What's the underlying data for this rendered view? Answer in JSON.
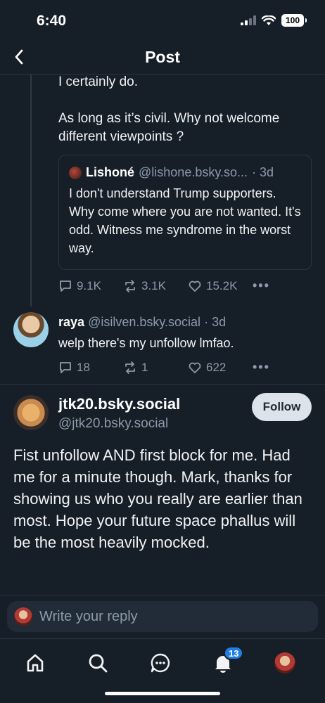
{
  "status_bar": {
    "time": "6:40",
    "battery": "100"
  },
  "header": {
    "title": "Post"
  },
  "parent_post": {
    "text_line1": "I certainly do.",
    "text_line2": "As long as it’s civil. Why not welcome different viewpoints ?",
    "quote": {
      "name": "Lishoné",
      "handle": "@lishone.bsky.so...",
      "time": "· 3d",
      "text": "I don't understand Trump supporters. Why come where you are not wanted. It's odd. Witness me syndrome in the worst way."
    },
    "replies": "9.1K",
    "reposts": "3.1K",
    "likes": "15.2K"
  },
  "reply_post": {
    "name": "raya",
    "handle": "@isilven.bsky.social",
    "time": "· 3d",
    "text": "welp there's my unfollow lmfao.",
    "replies": "18",
    "reposts": "1",
    "likes": "622"
  },
  "main_post": {
    "display_name": "jtk20.bsky.social",
    "handle": "@jtk20.bsky.social",
    "follow_label": "Follow",
    "text": "Fist unfollow AND first block for me. Had me for a minute though. Mark, thanks for showing us who you really are earlier than most. Hope your future space phallus will be the most heavily mocked."
  },
  "composer": {
    "placeholder": "Write your reply"
  },
  "tabbar": {
    "notifications_badge": "13"
  },
  "colors": {
    "background": "#161e27",
    "accent": "#1e7ee8",
    "muted": "#8c9aab"
  }
}
